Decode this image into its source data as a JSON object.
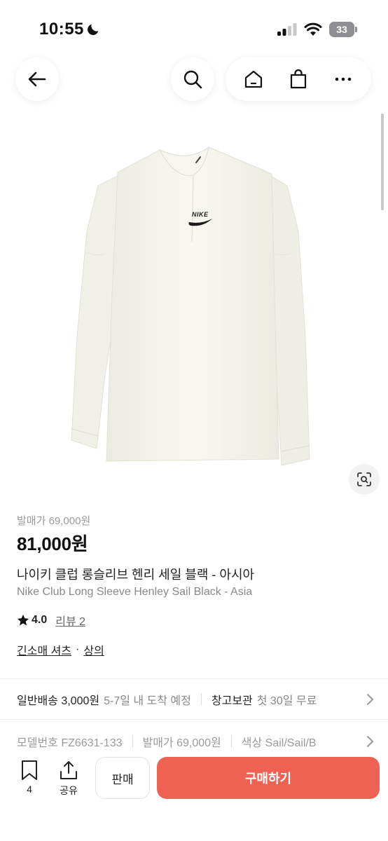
{
  "status_bar": {
    "time": "10:55",
    "battery": "33"
  },
  "product": {
    "release_price": "발매가 69,000원",
    "price": "81,000원",
    "title_ko": "나이키 클럽 롱슬리브 헨리 세일 블랙 - 아시아",
    "title_en": "Nike Club Long Sleeve Henley Sail Black - Asia",
    "rating": "4.0",
    "review_link": "리뷰 2",
    "categories": [
      "긴소매 셔츠",
      "상의"
    ],
    "category_separator": "·",
    "logo_text": "NIKE"
  },
  "shipping": {
    "label": "일반배송 3,000원",
    "detail": "5-7일 내 도착 예정",
    "storage_label": "창고보관",
    "storage_detail": "첫 30일 무료"
  },
  "specs": {
    "model": "모델번호 FZ6631-133",
    "release": "발매가 69,000원",
    "color": "색상 Sail/Sail/B"
  },
  "bottom_bar": {
    "save_count": "4",
    "share_label": "공유",
    "sell_label": "판매",
    "buy_label": "구매하기"
  },
  "colors": {
    "accent": "#ef6253",
    "shirt": "#f5f3ea"
  },
  "icons": [
    "moon-icon",
    "signal-icon",
    "wifi-icon",
    "back-arrow-icon",
    "search-icon",
    "home-icon",
    "shopping-bag-icon",
    "more-icon",
    "lens-icon",
    "star-icon",
    "chevron-right-icon",
    "bookmark-icon",
    "share-icon"
  ]
}
